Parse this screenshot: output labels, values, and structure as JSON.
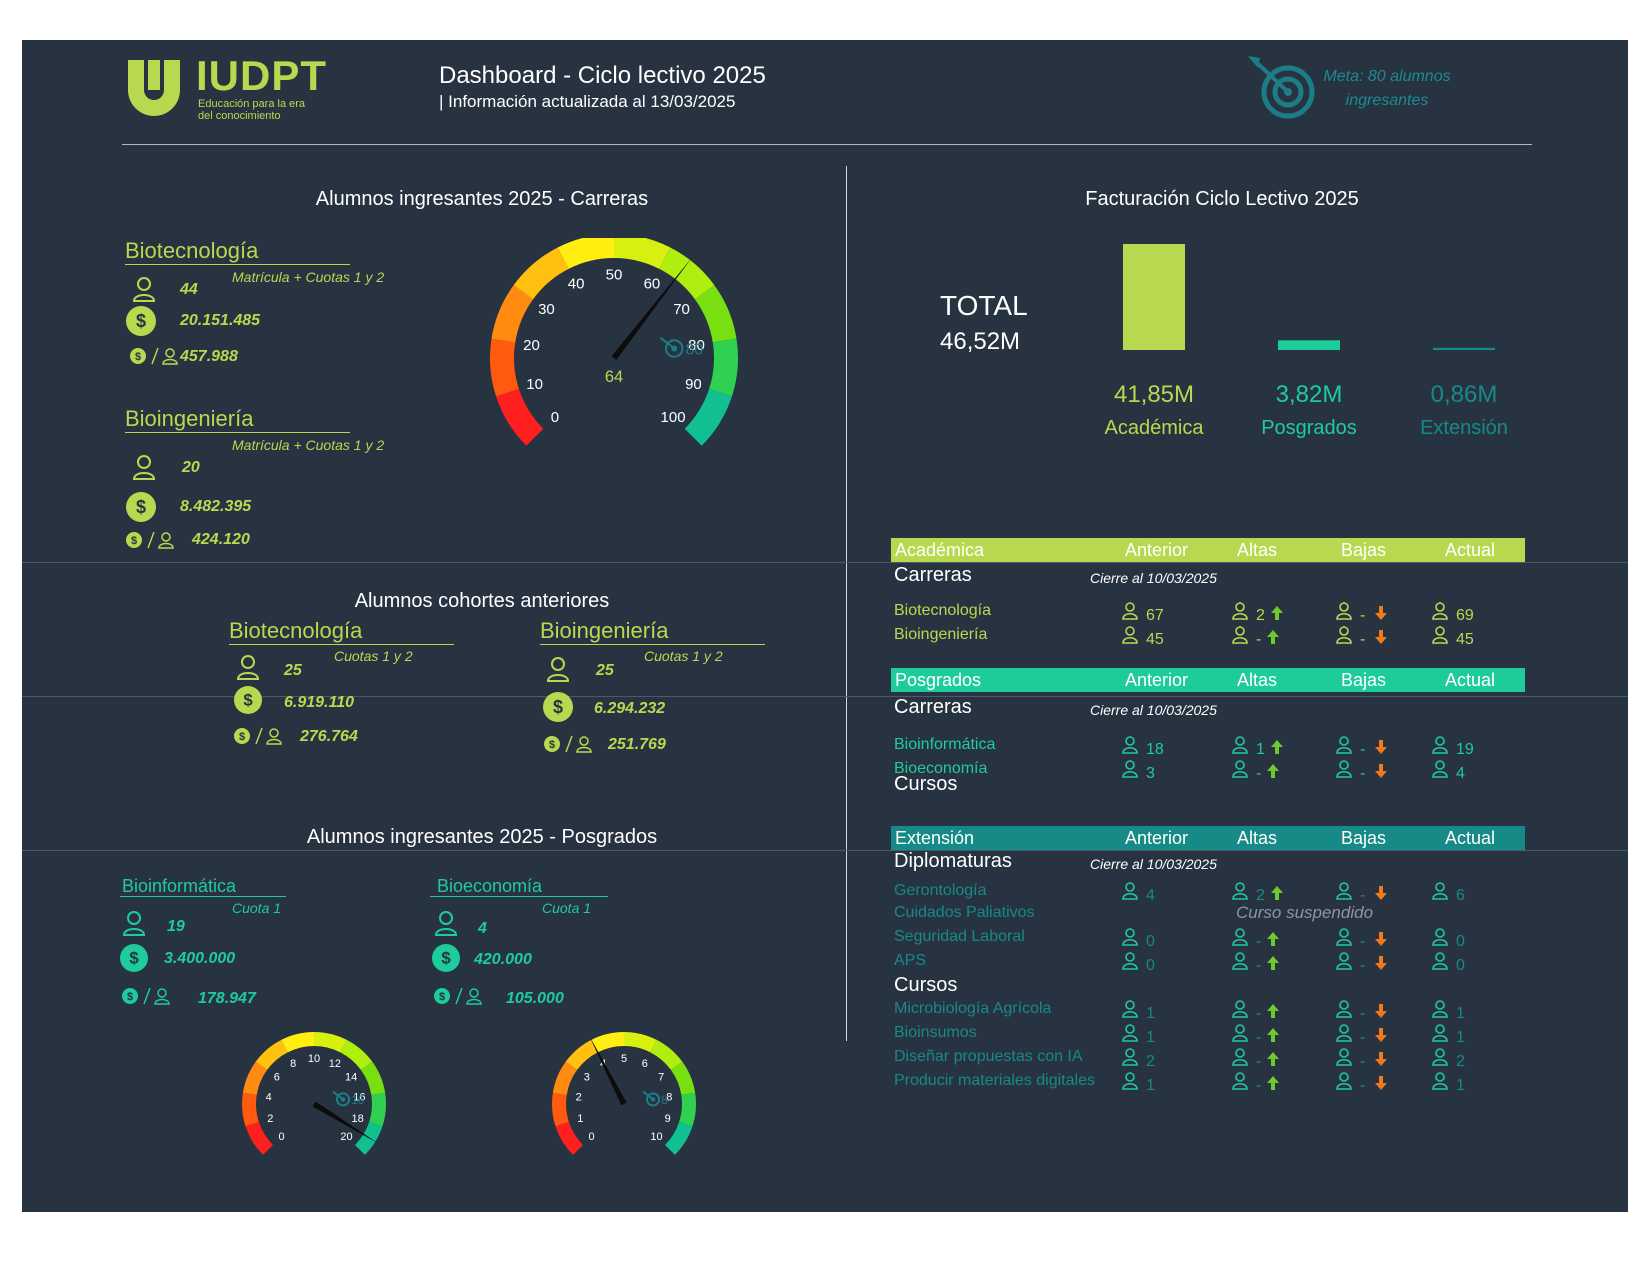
{
  "header": {
    "logo_text": "IUDPT",
    "logo_tagline_1": "Educación para la era",
    "logo_tagline_2": "del conocimiento",
    "title": "Dashboard - Ciclo lectivo 2025",
    "subtitle": "| Información actualizada al  13/03/2025",
    "goal_line1": "Meta: 80 alumnos",
    "goal_line2": "ingresantes"
  },
  "ingresantes_carreras": {
    "title": "Alumnos ingresantes 2025 - Carreras",
    "items": [
      {
        "name": "Biotecnología",
        "note": "Matrícula + Cuotas 1 y 2",
        "students": "44",
        "amount": "20.151.485",
        "per_student": "457.988"
      },
      {
        "name": "Bioingeniería",
        "note": "Matrícula + Cuotas 1 y 2",
        "students": "20",
        "amount": "8.482.395",
        "per_student": "424.120"
      }
    ],
    "gauge": {
      "value": "64",
      "target": "80",
      "ticks": [
        "0",
        "10",
        "20",
        "30",
        "40",
        "50",
        "60",
        "70",
        "80",
        "90",
        "100"
      ],
      "value_num": 64,
      "max": 100
    }
  },
  "cohortes": {
    "title": "Alumnos cohortes anteriores",
    "items": [
      {
        "name": "Biotecnología",
        "note": "Cuotas 1 y 2",
        "students": "25",
        "amount": "6.919.110",
        "per_student": "276.764"
      },
      {
        "name": "Bioingeniería",
        "note": "Cuotas 1 y 2",
        "students": "25",
        "amount": "6.294.232",
        "per_student": "251.769"
      }
    ]
  },
  "ingresantes_posgrados": {
    "title": "Alumnos ingresantes 2025 - Posgrados",
    "items": [
      {
        "name": "Bioinformática",
        "note": "Cuota 1",
        "students": "19",
        "amount": "3.400.000",
        "per_student": "178.947"
      },
      {
        "name": "Bioeconomía",
        "note": "Cuota 1",
        "students": "4",
        "amount": "420.000",
        "per_student": "105.000"
      }
    ],
    "gauges": [
      {
        "ticks": [
          "0",
          "2",
          "4",
          "6",
          "8",
          "10",
          "12",
          "14",
          "16",
          "18",
          "20"
        ],
        "target": "16",
        "value_num": 19,
        "max": 20
      },
      {
        "ticks": [
          "0",
          "1",
          "2",
          "3",
          "4",
          "5",
          "6",
          "7",
          "8",
          "9",
          "10"
        ],
        "target": "8",
        "value_num": 4,
        "max": 10
      }
    ]
  },
  "facturacion": {
    "title": "Facturación Ciclo Lectivo 2025",
    "total_label": "TOTAL",
    "total_value": "46,52M",
    "chart_data": {
      "type": "bar",
      "categories": [
        "Académica",
        "Posgrados",
        "Extensión"
      ],
      "values": [
        41.85,
        3.82,
        0.86
      ],
      "value_labels": [
        "41,85M",
        "3,82M",
        "0,86M"
      ],
      "colors": [
        "#b8d94f",
        "#1ecb9a",
        "#168a86"
      ]
    }
  },
  "academica": {
    "header": [
      "Académica",
      "Anterior",
      "Altas",
      "Bajas",
      "Actual"
    ],
    "group": "Carreras",
    "note": "Cierre al  10/03/2025",
    "rows": [
      {
        "name": "Biotecnología",
        "anterior": "67",
        "altas": "2",
        "bajas": "-",
        "actual": "69"
      },
      {
        "name": "Bioingeniería",
        "anterior": "45",
        "altas": "-",
        "bajas": "-",
        "actual": "45"
      }
    ]
  },
  "posgrados": {
    "header": [
      "Posgrados",
      "Anterior",
      "Altas",
      "Bajas",
      "Actual"
    ],
    "group": "Carreras",
    "note": "Cierre al  10/03/2025",
    "rows": [
      {
        "name": "Bioinformática",
        "anterior": "18",
        "altas": "1",
        "bajas": "-",
        "actual": "19"
      },
      {
        "name": "Bioeconomía",
        "anterior": "3",
        "altas": "-",
        "bajas": "-",
        "actual": "4"
      }
    ],
    "group2": "Cursos"
  },
  "extension": {
    "header": [
      "Extensión",
      "Anterior",
      "Altas",
      "Bajas",
      "Actual"
    ],
    "group": "Diplomaturas",
    "note": "Cierre al  10/03/2025",
    "rows": [
      {
        "name": "Gerontología",
        "anterior": "4",
        "altas": "2",
        "bajas": "-",
        "actual": "6"
      },
      {
        "name": "Seguridad Laboral",
        "anterior": "0",
        "altas": "-",
        "bajas": "-",
        "actual": "0"
      },
      {
        "name": "APS",
        "anterior": "0",
        "altas": "-",
        "bajas": "-",
        "actual": "0"
      }
    ],
    "suspended_name": "Cuidados Paliativos",
    "suspended_note": "Curso suspendido",
    "group2": "Cursos",
    "cursos": [
      {
        "name": "Microbiología Agrícola",
        "anterior": "1",
        "altas": "-",
        "bajas": "-",
        "actual": "1"
      },
      {
        "name": "Bioinsumos",
        "anterior": "1",
        "altas": "-",
        "bajas": "-",
        "actual": "1"
      },
      {
        "name": "Diseñar propuestas con IA",
        "anterior": "2",
        "altas": "-",
        "bajas": "-",
        "actual": "2"
      },
      {
        "name": "Producir materiales digitales",
        "anterior": "1",
        "altas": "-",
        "bajas": "-",
        "actual": "1"
      }
    ]
  }
}
